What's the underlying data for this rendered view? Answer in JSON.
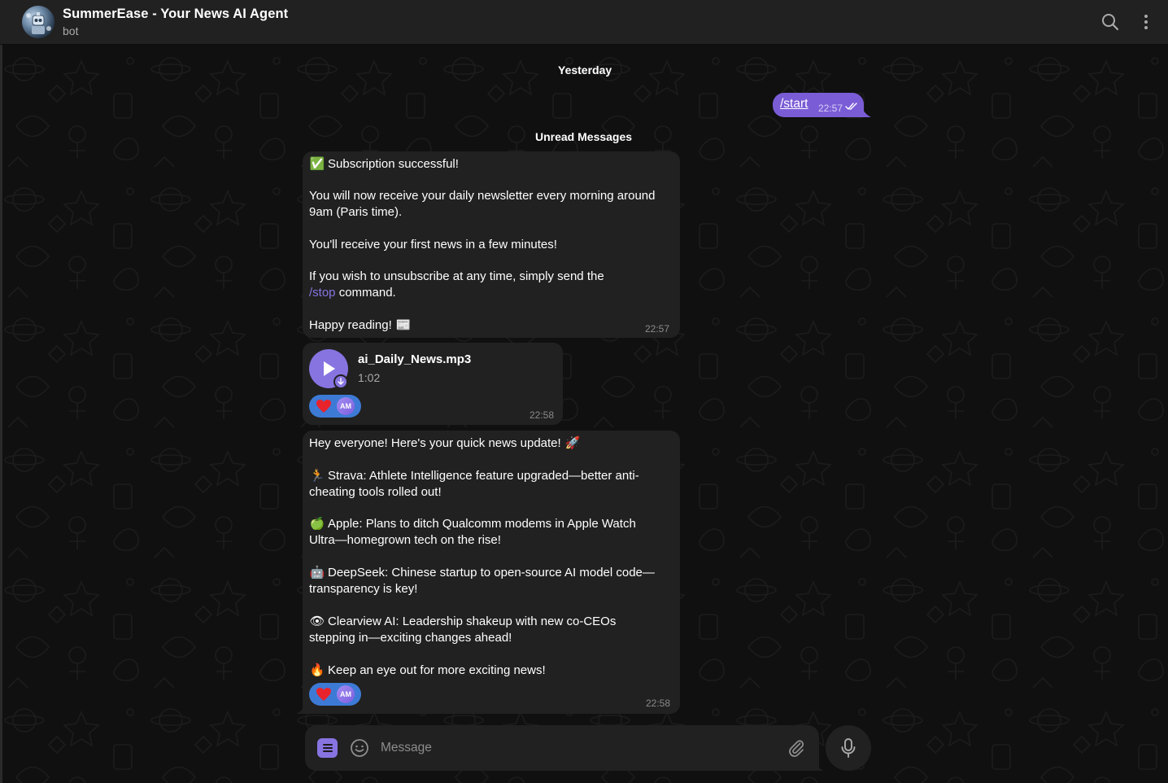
{
  "header": {
    "title": "SummerEase - Your News AI Agent",
    "status": "bot"
  },
  "separators": {
    "date": "Yesterday",
    "unread": "Unread Messages"
  },
  "outgoing": {
    "text": "/start",
    "time": "22:57"
  },
  "message1": {
    "line1": "Subscription successful!",
    "line2": "You will now receive your daily newsletter every morning around",
    "line3": "9am (Paris time).",
    "line4": "You'll receive your first news in a few minutes!",
    "line5": "If you wish to unsubscribe at any time, simply send the",
    "command": "/stop",
    "line6_rest": " command.",
    "line7": "Happy reading!",
    "emoji_start": "✅",
    "emoji_end": "📰",
    "time": "22:57"
  },
  "audio": {
    "file_name": "ai_Daily_News.mp3",
    "duration": "1:02",
    "reaction_initials": "AM",
    "time": "22:58"
  },
  "message3": {
    "intro": "Hey everyone! Here's your quick news update!",
    "intro_emoji": "🚀",
    "items": [
      {
        "emoji": "🏃",
        "line1": "Strava: Athlete Intelligence feature upgraded—better anti-",
        "line2": "cheating tools rolled out!"
      },
      {
        "emoji": "🍏",
        "line1": "Apple: Plans to ditch Qualcomm modems in Apple Watch",
        "line2": "Ultra—homegrown tech on the rise!"
      },
      {
        "emoji": "🤖",
        "line1": "DeepSeek: Chinese startup to open-source AI model code—",
        "line2": "transparency is key!"
      },
      {
        "emoji": "👁",
        "line1": "Clearview AI: Leadership shakeup with new co-CEOs",
        "line2": "stepping in—exciting changes ahead!"
      }
    ],
    "outro": "Keep an eye out for more exciting news!",
    "outro_emoji": "🔥",
    "reaction_initials": "AM",
    "time": "22:58"
  },
  "composer": {
    "placeholder": "Message"
  },
  "colors": {
    "accent": "#8774e1",
    "outgoing_bubble": "#7a5cd6",
    "incoming_bubble": "#212121",
    "reaction": "#3d7ad6"
  }
}
